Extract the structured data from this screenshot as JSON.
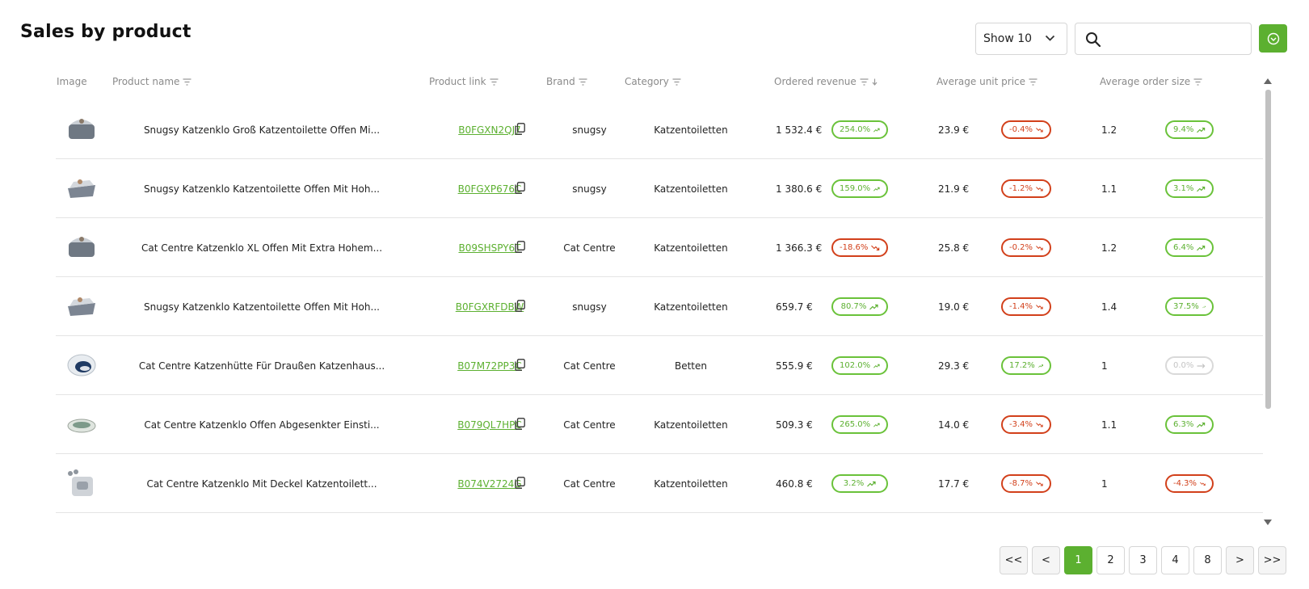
{
  "page": {
    "title": "Sales by product"
  },
  "controls": {
    "show_label": "Show 10",
    "search_placeholder": "",
    "accent": "#5cb030"
  },
  "columns": {
    "image": "Image",
    "product_name": "Product name",
    "product_link": "Product link",
    "brand": "Brand",
    "category": "Category",
    "ordered_revenue": "Ordered revenue",
    "average_unit_price": "Average unit price",
    "average_order_size": "Average order size"
  },
  "rows": [
    {
      "name": "Snugsy Katzenklo Groß Katzentoilette Offen Mi...",
      "link": "B0FGXN2QJ7",
      "brand": "snugsy",
      "category": "Katzentoiletten",
      "revenue": "1 532.4 €",
      "revenue_change": "254.0%",
      "revenue_trend": "up",
      "unit_price": "23.9 €",
      "unit_price_change": "-0.4%",
      "unit_price_trend": "down",
      "order_size": "1.2",
      "order_size_change": "9.4%",
      "order_size_trend": "up",
      "thumb": "litter-box-grey"
    },
    {
      "name": "Snugsy Katzenklo Katzentoilette Offen Mit Hoh...",
      "link": "B0FGXP676C",
      "brand": "snugsy",
      "category": "Katzentoiletten",
      "revenue": "1 380.6 €",
      "revenue_change": "159.0%",
      "revenue_trend": "up",
      "unit_price": "21.9 €",
      "unit_price_change": "-1.2%",
      "unit_price_trend": "down",
      "order_size": "1.1",
      "order_size_change": "3.1%",
      "order_size_trend": "up",
      "thumb": "litter-box-open"
    },
    {
      "name": "Cat Centre Katzenklo XL Offen Mit Extra Hohem...",
      "link": "B09SHSPY6T",
      "brand": "Cat Centre",
      "category": "Katzentoiletten",
      "revenue": "1 366.3 €",
      "revenue_change": "-18.6%",
      "revenue_trend": "down",
      "unit_price": "25.8 €",
      "unit_price_change": "-0.2%",
      "unit_price_trend": "down",
      "order_size": "1.2",
      "order_size_change": "6.4%",
      "order_size_trend": "up",
      "thumb": "litter-box-grey"
    },
    {
      "name": "Snugsy Katzenklo Katzentoilette Offen Mit Hoh...",
      "link": "B0FGXRFDBW",
      "brand": "snugsy",
      "category": "Katzentoiletten",
      "revenue": "659.7 €",
      "revenue_change": "80.7%",
      "revenue_trend": "up",
      "unit_price": "19.0 €",
      "unit_price_change": "-1.4%",
      "unit_price_trend": "down",
      "order_size": "1.4",
      "order_size_change": "37.5%",
      "order_size_trend": "up",
      "thumb": "litter-box-open"
    },
    {
      "name": "Cat Centre Katzenhütte Für Draußen Katzenhaus...",
      "link": "B07M72PP3C",
      "brand": "Cat Centre",
      "category": "Betten",
      "revenue": "555.9 €",
      "revenue_change": "102.0%",
      "revenue_trend": "up",
      "unit_price": "29.3 €",
      "unit_price_change": "17.2%",
      "unit_price_trend": "up",
      "order_size": "1",
      "order_size_change": "0.0%",
      "order_size_trend": "flat",
      "thumb": "cat-house"
    },
    {
      "name": "Cat Centre Katzenklo Offen Abgesenkter Einsti...",
      "link": "B079QL7HPC",
      "brand": "Cat Centre",
      "category": "Katzentoiletten",
      "revenue": "509.3 €",
      "revenue_change": "265.0%",
      "revenue_trend": "up",
      "unit_price": "14.0 €",
      "unit_price_change": "-3.4%",
      "unit_price_trend": "down",
      "order_size": "1.1",
      "order_size_change": "6.3%",
      "order_size_trend": "up",
      "thumb": "litter-tray"
    },
    {
      "name": "Cat Centre Katzenklo Mit Deckel Katzentoilett...",
      "link": "B074V2724G",
      "brand": "Cat Centre",
      "category": "Katzentoiletten",
      "revenue": "460.8 €",
      "revenue_change": "3.2%",
      "revenue_trend": "up",
      "unit_price": "17.7 €",
      "unit_price_change": "-8.7%",
      "unit_price_trend": "down",
      "order_size": "1",
      "order_size_change": "-4.3%",
      "order_size_trend": "down",
      "thumb": "covered-litter-box"
    },
    {
      "name": "",
      "link": "",
      "brand": "",
      "category": "",
      "revenue": "",
      "revenue_change": "",
      "revenue_trend": "down",
      "unit_price": "",
      "unit_price_change": "",
      "unit_price_trend": "down",
      "order_size": "",
      "order_size_change": "",
      "order_size_trend": "down",
      "thumb": "litter-box-grey"
    }
  ],
  "pagination": [
    "<<",
    "<",
    "1",
    "2",
    "3",
    "4",
    "8",
    ">",
    ">>"
  ],
  "pagination_active": "1",
  "colors": {
    "up": "#5cb030",
    "down": "#d2401b",
    "flat": "#c4c4c4"
  }
}
